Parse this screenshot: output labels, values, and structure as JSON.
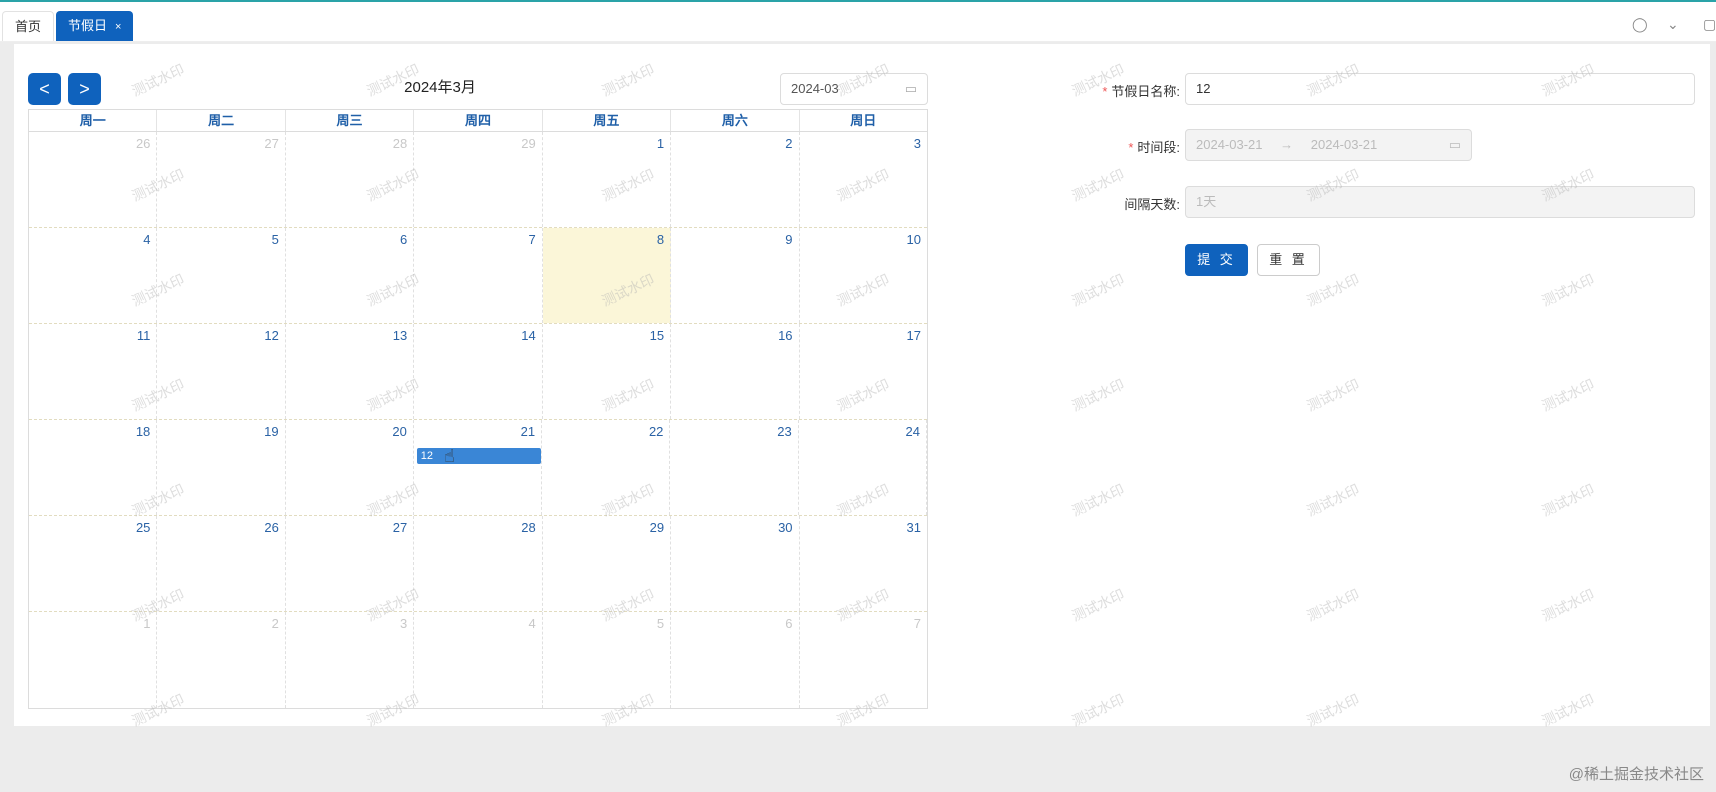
{
  "tabs": [
    {
      "label": "首页"
    },
    {
      "label": "节假日",
      "close": "×"
    }
  ],
  "top_icons": [
    "refresh-icon",
    "chevron-down-icon",
    "fullscreen-icon"
  ],
  "calendar": {
    "prev": "<",
    "next": ">",
    "title": "2024年3月",
    "month_value": "2024-03",
    "weekdays": [
      "周一",
      "周二",
      "周三",
      "周四",
      "周五",
      "周六",
      "周日"
    ],
    "weeks": [
      [
        {
          "d": "26",
          "o": true
        },
        {
          "d": "27",
          "o": true
        },
        {
          "d": "28",
          "o": true
        },
        {
          "d": "29",
          "o": true
        },
        {
          "d": "1"
        },
        {
          "d": "2"
        },
        {
          "d": "3"
        }
      ],
      [
        {
          "d": "4"
        },
        {
          "d": "5"
        },
        {
          "d": "6"
        },
        {
          "d": "7"
        },
        {
          "d": "8",
          "today": true
        },
        {
          "d": "9"
        },
        {
          "d": "10"
        }
      ],
      [
        {
          "d": "11"
        },
        {
          "d": "12"
        },
        {
          "d": "13"
        },
        {
          "d": "14"
        },
        {
          "d": "15"
        },
        {
          "d": "16"
        },
        {
          "d": "17"
        }
      ],
      [
        {
          "d": "18"
        },
        {
          "d": "19"
        },
        {
          "d": "20"
        },
        {
          "d": "21"
        },
        {
          "d": "22"
        },
        {
          "d": "23"
        },
        {
          "d": "24"
        }
      ],
      [
        {
          "d": "25"
        },
        {
          "d": "26"
        },
        {
          "d": "27"
        },
        {
          "d": "28"
        },
        {
          "d": "29"
        },
        {
          "d": "30"
        },
        {
          "d": "31"
        }
      ],
      [
        {
          "d": "1",
          "o": true
        },
        {
          "d": "2",
          "o": true
        },
        {
          "d": "3",
          "o": true
        },
        {
          "d": "4",
          "o": true
        },
        {
          "d": "5",
          "o": true
        },
        {
          "d": "6",
          "o": true
        },
        {
          "d": "7",
          "o": true
        }
      ]
    ],
    "events": [
      {
        "title": "12",
        "week": 3,
        "col": 3
      }
    ]
  },
  "form": {
    "name_label": "节假日名称:",
    "name_value": "12",
    "range_label": "时间段:",
    "range_start": "2024-03-21",
    "range_sep": "→",
    "range_end": "2024-03-21",
    "days_label": "间隔天数:",
    "days_value": "1天",
    "submit": "提 交",
    "reset": "重 置"
  },
  "watermark": "测试水印",
  "credit": "@稀土掘金技术社区"
}
